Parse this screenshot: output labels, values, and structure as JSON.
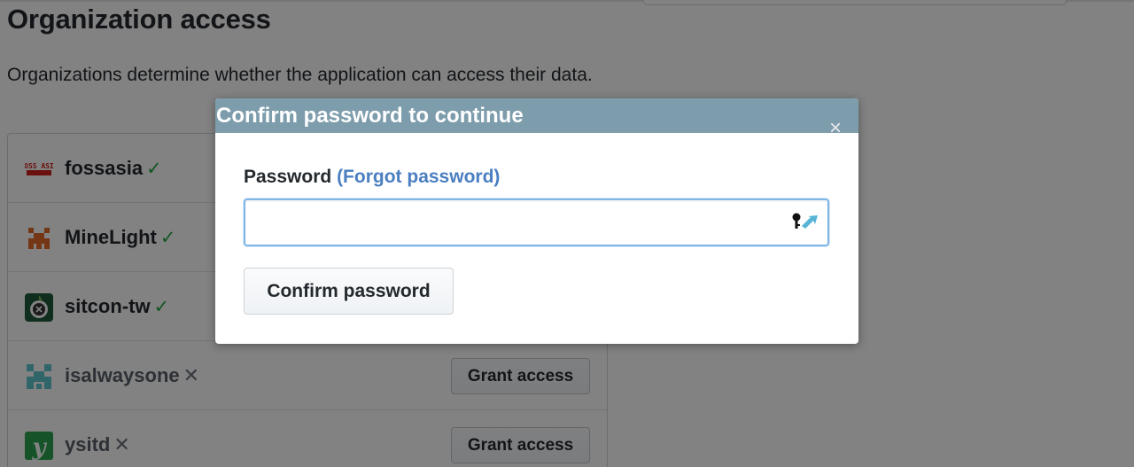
{
  "section": {
    "title": "Organization access",
    "description": "Organizations determine whether the application can access their data."
  },
  "organizations": [
    {
      "name": "fossasia",
      "status": "granted",
      "logo_icon": "fossasia-logo-icon",
      "logo_text": "FOSS ASIA"
    },
    {
      "name": "MineLight",
      "status": "granted",
      "logo_icon": "minelight-logo-icon"
    },
    {
      "name": "sitcon-tw",
      "status": "granted",
      "logo_icon": "sitcon-logo-icon"
    },
    {
      "name": "isalwaysone",
      "status": "denied",
      "logo_icon": "isalwaysone-logo-icon",
      "action_label": "Grant access"
    },
    {
      "name": "ysitd",
      "status": "denied",
      "logo_icon": "ysitd-logo-icon",
      "logo_text": "y",
      "action_label": "Grant access"
    }
  ],
  "marks": {
    "granted": "✓",
    "denied": "✕"
  },
  "modal": {
    "title": "Confirm password to continue",
    "close_glyph": "×",
    "password_label": "Password",
    "forgot_link": "(Forgot password)",
    "password_value": "",
    "confirm_button": "Confirm password"
  },
  "colors": {
    "modal_header": "#7e9dac",
    "link": "#4a7fc1",
    "check": "#28a745",
    "input_focus": "#7fb6e6"
  }
}
